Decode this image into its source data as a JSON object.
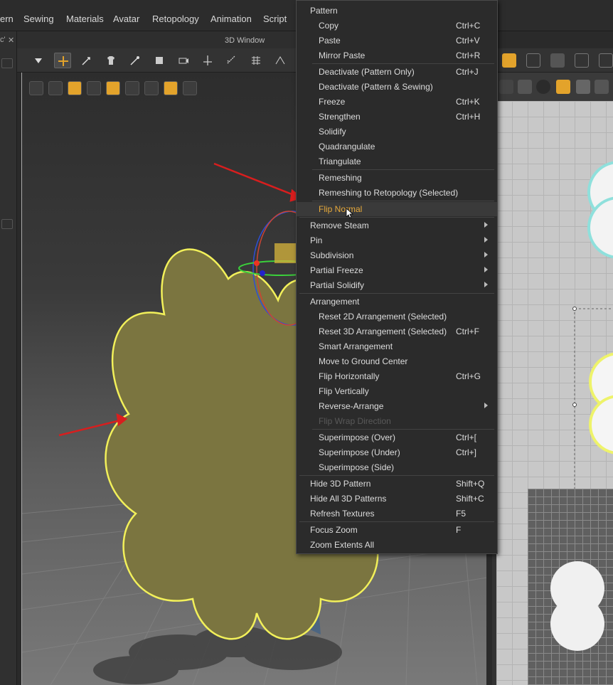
{
  "menubar": {
    "items": [
      "ern",
      "Sewing",
      "Materials",
      "Avatar",
      "Retopology",
      "Animation",
      "Script"
    ]
  },
  "left_dock": {
    "tab_label": "c'",
    "tab_close": "✕"
  },
  "window3d": {
    "title": "3D Window"
  },
  "context_menu": {
    "accent": "#e7a93a",
    "sections": [
      {
        "header": "Pattern",
        "items": [
          {
            "label": "Copy",
            "shortcut": "Ctrl+C"
          },
          {
            "label": "Paste",
            "shortcut": "Ctrl+V"
          },
          {
            "label": "Mirror Paste",
            "shortcut": "Ctrl+R"
          }
        ]
      }
    ],
    "labels": {
      "pattern": "Pattern",
      "copy": "Copy",
      "copy_sc": "Ctrl+C",
      "paste": "Paste",
      "paste_sc": "Ctrl+V",
      "mirror_paste": "Mirror Paste",
      "mirror_paste_sc": "Ctrl+R",
      "deactivate_pattern_only": "Deactivate (Pattern Only)",
      "deactivate_pattern_only_sc": "Ctrl+J",
      "deactivate_pattern_sewing": "Deactivate (Pattern & Sewing)",
      "freeze": "Freeze",
      "freeze_sc": "Ctrl+K",
      "strengthen": "Strengthen",
      "strengthen_sc": "Ctrl+H",
      "solidify": "Solidify",
      "quadrangulate": "Quadrangulate",
      "triangulate": "Triangulate",
      "remeshing": "Remeshing",
      "remeshing_retopology": "Remeshing to Retopology (Selected)",
      "flip_normal": "Flip Normal",
      "remove_steam": "Remove Steam",
      "pin": "Pin",
      "subdivision": "Subdivision",
      "partial_freeze": "Partial Freeze",
      "partial_solidify": "Partial Solidify",
      "arrangement": "Arrangement",
      "reset_2d": "Reset 2D Arrangement (Selected)",
      "reset_3d": "Reset 3D Arrangement (Selected)",
      "reset_3d_sc": "Ctrl+F",
      "smart_arrangement": "Smart Arrangement",
      "move_ground": "Move to Ground Center",
      "flip_horizontally": "Flip Horizontally",
      "flip_horizontally_sc": "Ctrl+G",
      "flip_vertically": "Flip Vertically",
      "reverse_arrange": "Reverse-Arrange",
      "flip_wrap": "Flip Wrap Direction",
      "superimpose_over": "Superimpose (Over)",
      "superimpose_over_sc": "Ctrl+[",
      "superimpose_under": "Superimpose (Under)",
      "superimpose_under_sc": "Ctrl+]",
      "superimpose_side": "Superimpose (Side)",
      "hide_3d": "Hide 3D Pattern",
      "hide_3d_sc": "Shift+Q",
      "hide_all_3d": "Hide All 3D Patterns",
      "hide_all_3d_sc": "Shift+C",
      "refresh_textures": "Refresh Textures",
      "refresh_textures_sc": "F5",
      "focus_zoom": "Focus Zoom",
      "focus_zoom_sc": "F",
      "zoom_extents": "Zoom Extents All"
    }
  },
  "colors": {
    "pattern_fill": "#7b7540",
    "pattern_outline": "#f2f05a",
    "arrow": "#d81e1e",
    "highlight_text": "#e7a93a"
  }
}
